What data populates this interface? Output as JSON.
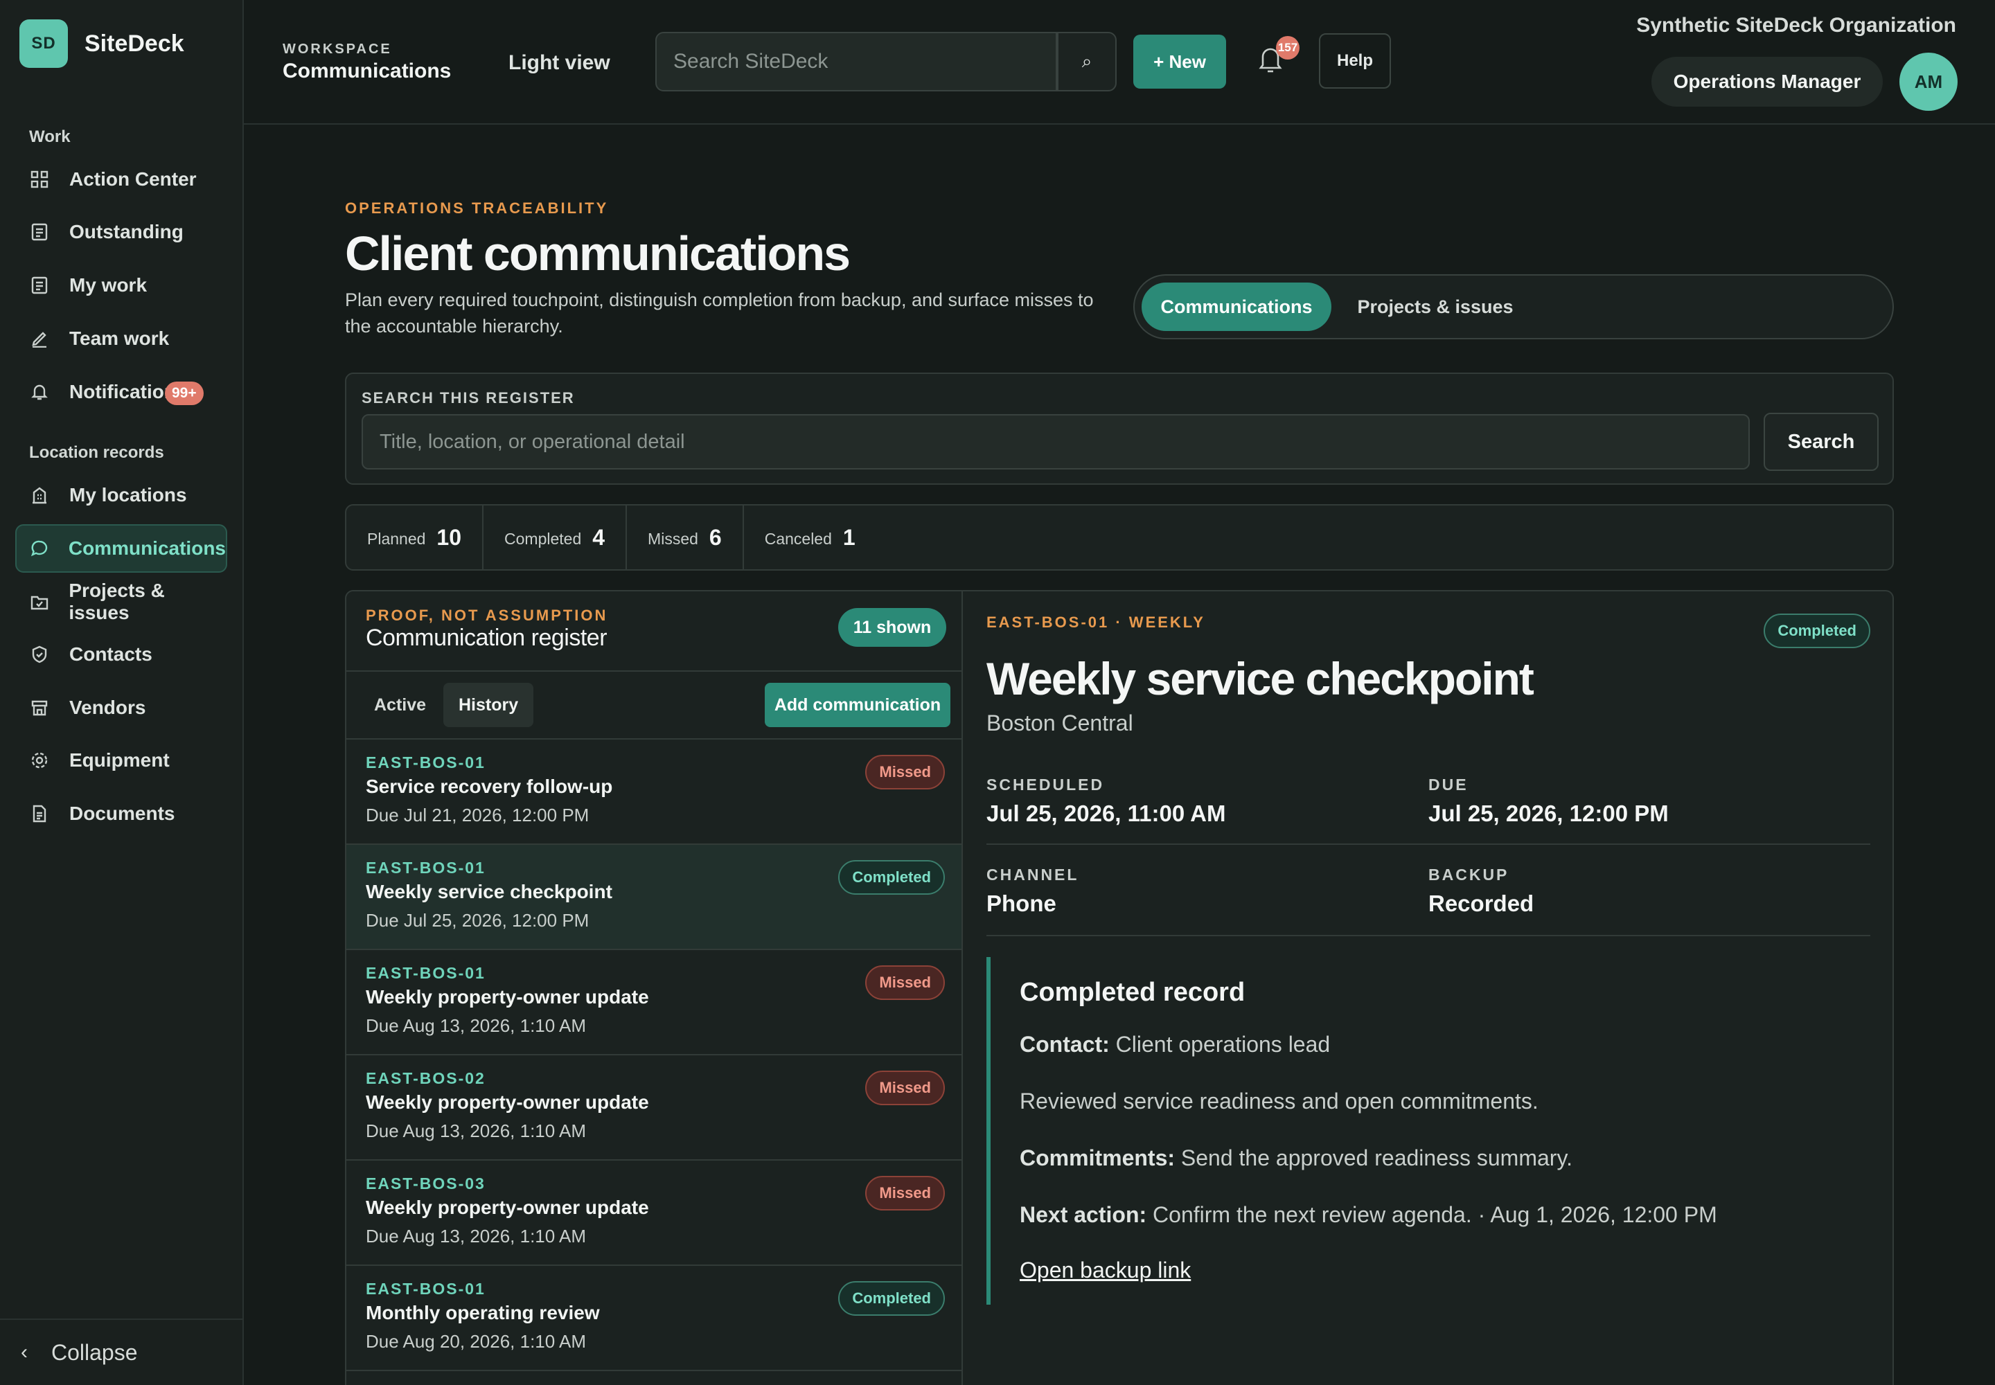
{
  "brand": {
    "logo": "SD",
    "name": "SiteDeck"
  },
  "sidebar": {
    "sections": [
      "Work",
      "Location records"
    ],
    "items": [
      {
        "label": "Action Center",
        "icon": "grid-icon"
      },
      {
        "label": "Outstanding",
        "icon": "checklist-icon"
      },
      {
        "label": "My work",
        "icon": "checklist-icon"
      },
      {
        "label": "Team work",
        "icon": "pen-icon"
      },
      {
        "label": "Notifications",
        "icon": "bell-icon",
        "badge": "99+"
      },
      {
        "label": "My locations",
        "icon": "building-icon"
      },
      {
        "label": "Communications",
        "icon": "chat-icon",
        "active": true
      },
      {
        "label": "Projects & issues",
        "icon": "folder-icon"
      },
      {
        "label": "Contacts",
        "icon": "shield-icon"
      },
      {
        "label": "Vendors",
        "icon": "store-icon"
      },
      {
        "label": "Equipment",
        "icon": "gear-icon"
      },
      {
        "label": "Documents",
        "icon": "document-icon"
      }
    ],
    "collapse_label": "Collapse"
  },
  "header": {
    "workspace_label": "WORKSPACE",
    "workspace_name": "Communications",
    "light_view": "Light view",
    "search_placeholder": "Search SiteDeck",
    "search_icon": "⌕",
    "new_label": "+ New",
    "notification_count": "157",
    "help_label": "Help",
    "org_name": "Synthetic SiteDeck Organization",
    "role": "Operations Manager",
    "avatar": "AM"
  },
  "page": {
    "eyebrow": "OPERATIONS TRACEABILITY",
    "title": "Client communications",
    "description": "Plan every required touchpoint, distinguish completion from backup, and surface misses to the accountable hierarchy.",
    "tabs": [
      "Communications",
      "Projects & issues"
    ],
    "active_tab": 0
  },
  "register_search": {
    "label": "SEARCH THIS REGISTER",
    "placeholder": "Title, location, or operational detail",
    "button": "Search"
  },
  "stats": [
    {
      "label": "Planned",
      "value": "10"
    },
    {
      "label": "Completed",
      "value": "4"
    },
    {
      "label": "Missed",
      "value": "6"
    },
    {
      "label": "Canceled",
      "value": "1"
    }
  ],
  "register": {
    "eyebrow": "PROOF, NOT ASSUMPTION",
    "title": "Communication register",
    "shown": "11 shown",
    "tabs": [
      "Active",
      "History"
    ],
    "add_label": "Add communication",
    "rows": [
      {
        "code": "EAST-BOS-01",
        "title": "Service recovery follow-up",
        "due": "Due Jul 21, 2026, 12:00 PM",
        "status": "Missed"
      },
      {
        "code": "EAST-BOS-01",
        "title": "Weekly service checkpoint",
        "due": "Due Jul 25, 2026, 12:00 PM",
        "status": "Completed",
        "selected": true
      },
      {
        "code": "EAST-BOS-01",
        "title": "Weekly property-owner update",
        "due": "Due Aug 13, 2026, 1:10 AM",
        "status": "Missed"
      },
      {
        "code": "EAST-BOS-02",
        "title": "Weekly property-owner update",
        "due": "Due Aug 13, 2026, 1:10 AM",
        "status": "Missed"
      },
      {
        "code": "EAST-BOS-03",
        "title": "Weekly property-owner update",
        "due": "Due Aug 13, 2026, 1:10 AM",
        "status": "Missed"
      },
      {
        "code": "EAST-BOS-01",
        "title": "Monthly operating review",
        "due": "Due Aug 20, 2026, 1:10 AM",
        "status": "Completed"
      }
    ]
  },
  "detail": {
    "eyebrow": "EAST-BOS-01 · WEEKLY",
    "status": "Completed",
    "title": "Weekly service checkpoint",
    "location": "Boston Central",
    "scheduled_label": "SCHEDULED",
    "scheduled": "Jul 25, 2026, 11:00 AM",
    "due_label": "DUE",
    "due": "Jul 25, 2026, 12:00 PM",
    "channel_label": "CHANNEL",
    "channel": "Phone",
    "backup_label": "BACKUP",
    "backup": "Recorded",
    "record": {
      "title": "Completed record",
      "contact_label": "Contact:",
      "contact": "Client operations lead",
      "summary": "Reviewed service readiness and open commitments.",
      "commitments_label": "Commitments:",
      "commitments": "Send the approved readiness summary.",
      "next_label": "Next action:",
      "next": "Confirm the next review agenda. · Aug 1, 2026, 12:00 PM",
      "link": "Open backup link"
    }
  },
  "colors": {
    "accent": "#2b8a77",
    "accent_light": "#5fc6ae",
    "eyebrow": "#e89a4e",
    "missed": "#f19a8a",
    "background": "#151b19"
  }
}
